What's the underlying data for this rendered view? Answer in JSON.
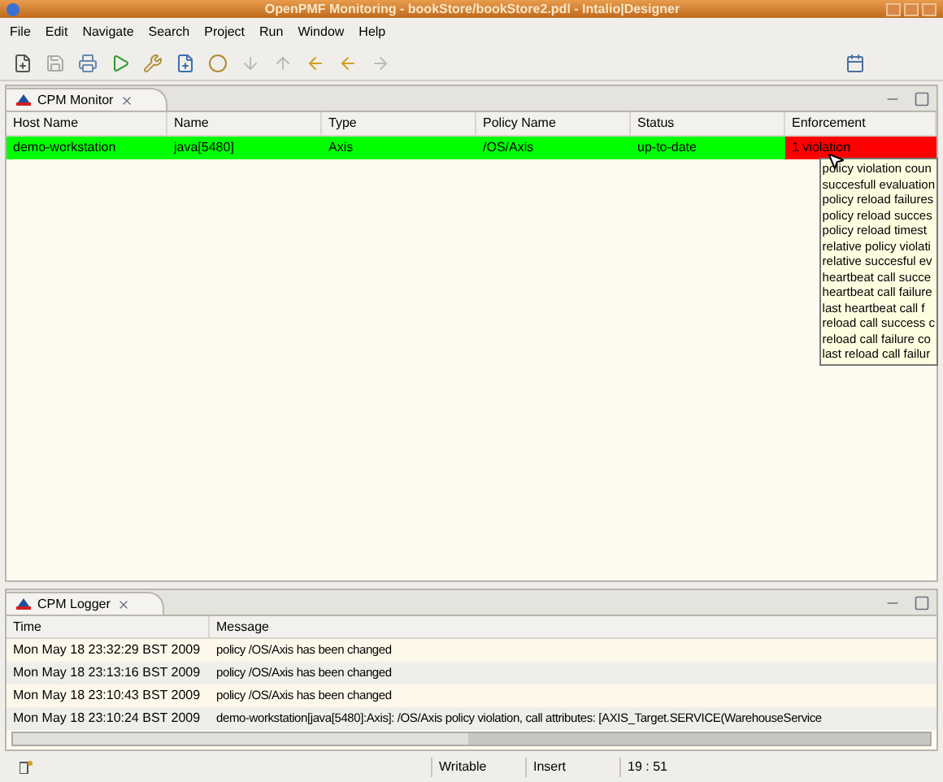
{
  "window": {
    "title": "OpenPMF Monitoring - bookStore/bookStore2.pdl - Intalio|Designer"
  },
  "menu": [
    "File",
    "Edit",
    "Navigate",
    "Search",
    "Project",
    "Run",
    "Window",
    "Help"
  ],
  "monitor": {
    "tab": "CPM Monitor",
    "columns": [
      "Host Name",
      "Name",
      "Type",
      "Policy Name",
      "Status",
      "Enforcement"
    ],
    "rows": [
      {
        "cells": [
          {
            "text": "demo-workstation",
            "color": "#00ff00"
          },
          {
            "text": "java[5480]",
            "color": "#00ff00"
          },
          {
            "text": "Axis",
            "color": "#00ff00"
          },
          {
            "text": "/OS/Axis",
            "color": "#00ff00"
          },
          {
            "text": "up-to-date",
            "color": "#00ff00"
          },
          {
            "text": "1 violation",
            "color": "#ff0000"
          }
        ]
      }
    ],
    "tooltip": [
      "policy violation coun",
      "succesfull evaluation",
      "policy reload failures",
      "policy reload succes",
      "policy reload timest",
      "relative policy violati",
      "relative succesful ev",
      "heartbeat call succe",
      "heartbeat call failure",
      "last heartbeat call f",
      "reload call success c",
      "reload call failure co",
      "last reload call failur"
    ]
  },
  "logger": {
    "tab": "CPM Logger",
    "columns": [
      "Time",
      "Message"
    ],
    "rows": [
      [
        "Mon May 18 23:32:29 BST 2009",
        "policy /OS/Axis has been changed"
      ],
      [
        "Mon May 18 23:13:16 BST 2009",
        "policy /OS/Axis has been changed"
      ],
      [
        "Mon May 18 23:10:43 BST 2009",
        "policy /OS/Axis has been changed"
      ],
      [
        "Mon May 18 23:10:24 BST 2009",
        "demo-workstation[java[5480]:Axis]: /OS/Axis policy violation, call attributes: [AXIS_Target.SERVICE(WarehouseService"
      ]
    ]
  },
  "status_bar": [
    "Writable",
    "Insert",
    "19 : 51"
  ]
}
